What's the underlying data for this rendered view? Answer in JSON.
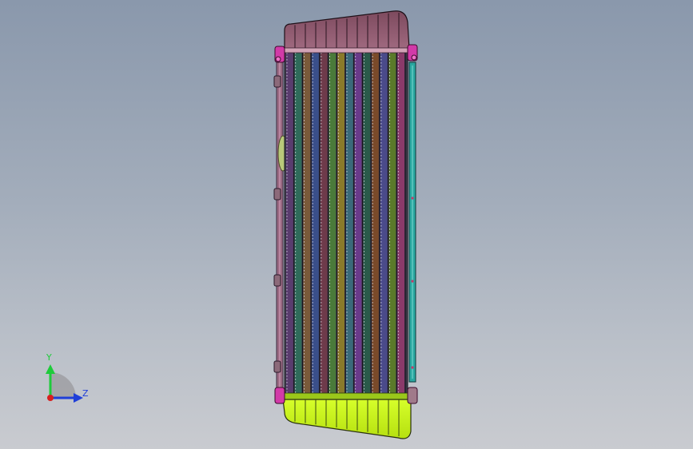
{
  "viewport": {
    "background_top": "#8a98ac",
    "background_bottom": "#c9cbd0"
  },
  "model": {
    "top_tank_color": "#8e5a6e",
    "bottom_tank_color": "#c8f21a",
    "core_fin_colors": [
      "#5a3c6e",
      "#2f6b5a",
      "#7a5a3a",
      "#3a4f8a",
      "#6e3a4a",
      "#4a7a3a",
      "#8a7a2a",
      "#3a6a7a",
      "#6a3a8a",
      "#2a5a4a",
      "#7a4a2a",
      "#4a4a8a",
      "#5a7a2a",
      "#8a3a6a"
    ],
    "side_bracket_color": "#2aa7a0",
    "fitting_color": "#d23aa8"
  },
  "triad": {
    "y_label": "Y",
    "z_label": "Z",
    "y_color": "#1ecb3a",
    "z_color": "#1f3fd8",
    "x_color": "#d81f1f"
  }
}
